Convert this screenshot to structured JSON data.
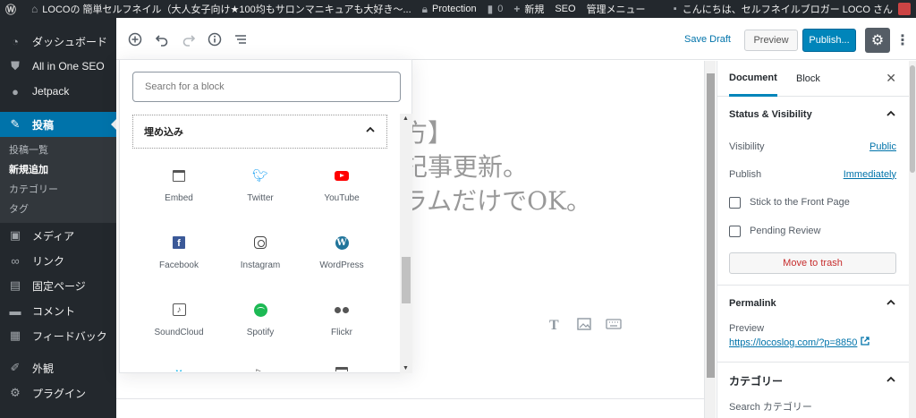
{
  "admin_bar": {
    "site_name": "LOCOの 簡単セルフネイル（大人女子向け★100均もサロンマニキュアも大好き〜...",
    "protection": "Protection",
    "comments_count": "0",
    "new_label": "新規",
    "seo_label": "SEO",
    "admin_menu_label": "管理メニュー",
    "greeting": "こんにちは、セルフネイルブロガー LOCO さん"
  },
  "sidebar": {
    "items": [
      {
        "label": "ダッシュボード",
        "icon": "dashboard-icon"
      },
      {
        "label": "All in One SEO",
        "icon": "shield-icon"
      },
      {
        "label": "Jetpack",
        "icon": "jetpack-icon"
      },
      {
        "label": "投稿",
        "icon": "pin-icon"
      },
      {
        "label": "メディア",
        "icon": "media-icon"
      },
      {
        "label": "リンク",
        "icon": "link-icon"
      },
      {
        "label": "固定ページ",
        "icon": "page-icon"
      },
      {
        "label": "コメント",
        "icon": "comment-icon"
      },
      {
        "label": "フィードバック",
        "icon": "feedback-icon"
      },
      {
        "label": "外観",
        "icon": "appearance-icon"
      },
      {
        "label": "プラグイン",
        "icon": "plugin-icon"
      }
    ],
    "submenu": [
      "投稿一覧",
      "新規追加",
      "カテゴリー",
      "タグ"
    ]
  },
  "toolbar": {
    "save_draft": "Save Draft",
    "preview": "Preview",
    "publish": "Publish..."
  },
  "inserter": {
    "search_placeholder": "Search for a block",
    "panel_title": "埋め込み",
    "blocks": [
      {
        "label": "Embed",
        "icon": "embed-icon"
      },
      {
        "label": "Twitter",
        "icon": "twitter-icon"
      },
      {
        "label": "YouTube",
        "icon": "youtube-icon"
      },
      {
        "label": "Facebook",
        "icon": "facebook-icon"
      },
      {
        "label": "Instagram",
        "icon": "instagram-icon"
      },
      {
        "label": "WordPress",
        "icon": "wordpress-icon"
      },
      {
        "label": "SoundCloud",
        "icon": "soundcloud-icon"
      },
      {
        "label": "Spotify",
        "icon": "spotify-icon"
      },
      {
        "label": "Flickr",
        "icon": "flickr-icon"
      }
    ]
  },
  "post": {
    "title_line1": "方】",
    "title_line2": "記事更新。",
    "title_line3": "ラムだけでOK。"
  },
  "settings": {
    "tab_document": "Document",
    "tab_block": "Block",
    "status_visibility": "Status & Visibility",
    "visibility_label": "Visibility",
    "visibility_value": "Public",
    "publish_label": "Publish",
    "publish_value": "Immediately",
    "stick_front": "Stick to the Front Page",
    "pending_review": "Pending Review",
    "move_to_trash": "Move to trash",
    "permalink_title": "Permalink",
    "preview_label": "Preview",
    "preview_url": "https://locoslog.com/?p=8850",
    "category_title": "カテゴリー",
    "category_search": "Search カテゴリー"
  }
}
